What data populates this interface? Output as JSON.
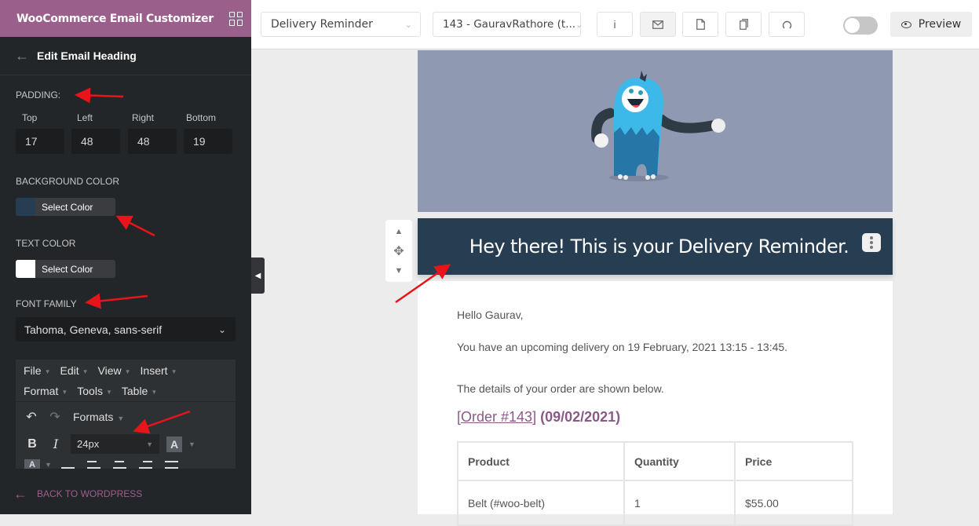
{
  "sidebar": {
    "app_title": "WooCommerce Email Customizer",
    "apps_icon": "grid-icon",
    "back_icon": "arrow-left-icon",
    "panel_title": "Edit Email Heading",
    "padding": {
      "label": "PADDING:",
      "fields": [
        {
          "label": "Top",
          "value": "17"
        },
        {
          "label": "Left",
          "value": "48"
        },
        {
          "label": "Right",
          "value": "48"
        },
        {
          "label": "Bottom",
          "value": "19"
        }
      ]
    },
    "background_color": {
      "label": "BACKGROUND COLOR",
      "button": "Select Color",
      "swatch": "#263d52"
    },
    "text_color": {
      "label": "TEXT COLOR",
      "button": "Select Color",
      "swatch": "#ffffff"
    },
    "font_family": {
      "label": "FONT FAMILY",
      "value": "Tahoma, Geneva, sans-serif"
    },
    "editor": {
      "menus_row1": [
        "File",
        "Edit",
        "View",
        "Insert"
      ],
      "menus_row2": [
        "Format",
        "Tools",
        "Table"
      ],
      "formats_label": "Formats",
      "font_size": "24px",
      "bold": "B",
      "italic": "I",
      "text_color_btn": "A",
      "bg_color_btn": "A"
    },
    "back_to_wp": "BACK TO WORDPRESS",
    "collapse_icon": "caret-left-icon"
  },
  "topbar": {
    "template_select": "Delivery Reminder",
    "order_select": "143 - GauravRathore (t...",
    "icon_buttons": [
      {
        "name": "info",
        "glyph": "i"
      },
      {
        "name": "email",
        "glyph": "✉"
      },
      {
        "name": "document",
        "glyph": "🗋"
      },
      {
        "name": "copy",
        "glyph": "❐"
      },
      {
        "name": "refresh",
        "glyph": "↻"
      }
    ],
    "toggle_on": false,
    "preview_label": "Preview"
  },
  "email": {
    "heading": "Hey there! This is your Delivery Reminder.",
    "greeting": "Hello Gaurav,",
    "delivery_line": "You have an upcoming delivery on 19 February, 2021 13:15 - 13:45.",
    "details_line": "The details of your order are shown below.",
    "order_link": "Order #143",
    "order_date": "(09/02/2021)",
    "table": {
      "headers": [
        "Product",
        "Quantity",
        "Price"
      ],
      "rows": [
        [
          "Belt (#woo-belt)",
          "1",
          "$55.00"
        ]
      ]
    }
  },
  "colors": {
    "brand": "#9b5f8c",
    "sidebar_bg": "#232629",
    "heading_bg": "#263d52",
    "hero_bg": "#8f99b1",
    "annotation": "#e8141a"
  }
}
